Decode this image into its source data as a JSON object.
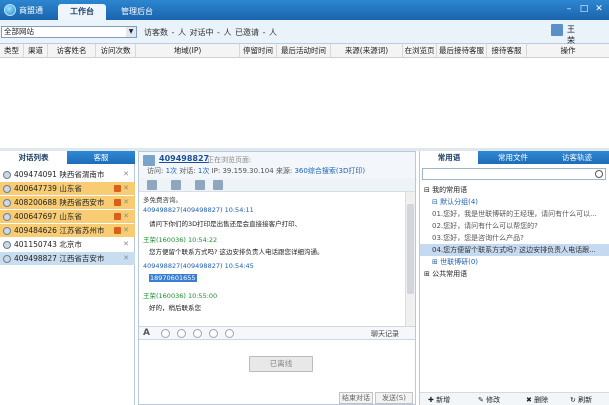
{
  "titlebar": {
    "app_name": "商盟通",
    "tabs": [
      "工作台",
      "管理后台"
    ]
  },
  "toolbar": {
    "site_selected": "全部网站",
    "stats": "访客数 - 人  对话中 - 人  已邀请 - 人",
    "user": "王荣"
  },
  "table": {
    "headers": [
      "类型",
      "渠道",
      "访客姓名",
      "访问次数",
      "地域(IP)",
      "停留时间",
      "最后活动时间",
      "来源(来源词)",
      "在浏览页",
      "最后接待客服",
      "接待客服",
      "操作"
    ]
  },
  "left": {
    "tabs": [
      "对话列表",
      "客服"
    ],
    "visitors": [
      {
        "text": "409474091 陕西省渭南市",
        "hl": false
      },
      {
        "text": "400647739 山东省",
        "hl": true
      },
      {
        "text": "408200688 陕西省西安市",
        "hl": true
      },
      {
        "text": "400647697 山东省",
        "hl": true
      },
      {
        "text": "409484626 江苏省苏州市",
        "hl": true
      },
      {
        "text": "401150743 北京市",
        "hl": false
      },
      {
        "text": "409498827 江西省吉安市",
        "hl": false,
        "sel": true
      }
    ]
  },
  "chat": {
    "id": "409498827",
    "browsing": "正在浏览页面:",
    "stats_a": "访问: ",
    "visits": "1次",
    "stats_b": " 对话: ",
    "chats": "1次",
    "stats_c": " IP: 39.159.30.104 来源: ",
    "source": "360综合搜索(3D打印)",
    "messages": [
      {
        "who": "409498827(409498827)",
        "time": "10:54:11",
        "text": "请问下你们的3D打印是出售还是会直接接客户打印、"
      },
      {
        "who": "王荣(160036)",
        "time": "10:54:22",
        "text": "您方便留个联系方式吗? 这边安排负责人电话跟您详细沟通。"
      },
      {
        "who": "409498827(409498827)",
        "time": "10:54:45",
        "text": "18970601655"
      },
      {
        "who": "王荣(160036)",
        "time": "10:55:00",
        "text": "好的，稍后联系您"
      }
    ],
    "top_cut": "多免费咨询。",
    "history": "聊天记录",
    "offline": "已离线",
    "end": "结束对话",
    "send": "发送(S)"
  },
  "right": {
    "tabs": [
      "常用语",
      "常用文件",
      "访客轨迹"
    ],
    "tree": {
      "root": "我的常用语",
      "group": "默认分组(4)",
      "items": [
        "01.您好，我是世联博研的王经理，请问有什么可以...",
        "02.您好，请问有什么可以帮您的?",
        "03.您好，您是咨询什么产品?",
        "04.您方便留个联系方式吗? 这边安排负责人电话跟..."
      ],
      "group2": "世联博研(0)",
      "public": "公共常用语"
    },
    "actions": [
      "新增",
      "修改",
      "删除",
      "刷新"
    ]
  }
}
